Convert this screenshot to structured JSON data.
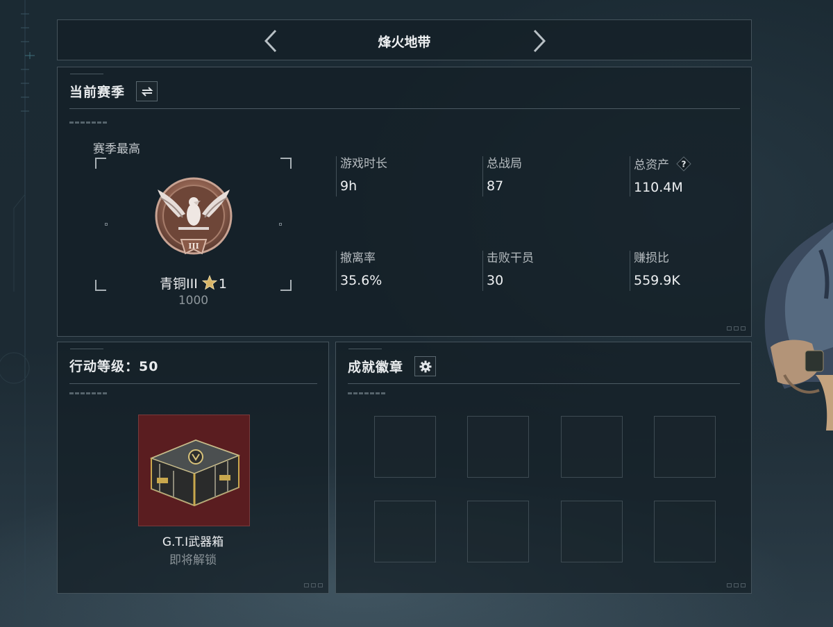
{
  "header": {
    "title": "烽火地带"
  },
  "season": {
    "title": "当前赛季",
    "best_label": "赛季最高",
    "rank": {
      "name": "青铜III",
      "stars": "1",
      "score": "1000",
      "medal_numeral": "III"
    },
    "stats": [
      {
        "label": "游戏时长",
        "value": "9h"
      },
      {
        "label": "总战局",
        "value": "87"
      },
      {
        "label": "总资产",
        "value": "110.4M",
        "help_icon": "?"
      },
      {
        "label": "撤离率",
        "value": "35.6%"
      },
      {
        "label": "击败干员",
        "value": "30"
      },
      {
        "label": "赚损比",
        "value": "559.9K"
      }
    ]
  },
  "action": {
    "title": "行动等级：50",
    "reward": {
      "name": "G.T.I武器箱",
      "status": "即将解锁"
    }
  },
  "achievements": {
    "title": "成就徽章",
    "slot_count": 8
  },
  "colors": {
    "accent_gold": "#d8b567",
    "bronze": "#9a6e5c",
    "crate_bg": "#5a1d20"
  },
  "icons": {
    "prev": "chevron-left-icon",
    "next": "chevron-right-icon",
    "swap": "swap-icon",
    "settings": "gear-icon",
    "help": "question-icon",
    "star": "star-icon"
  }
}
